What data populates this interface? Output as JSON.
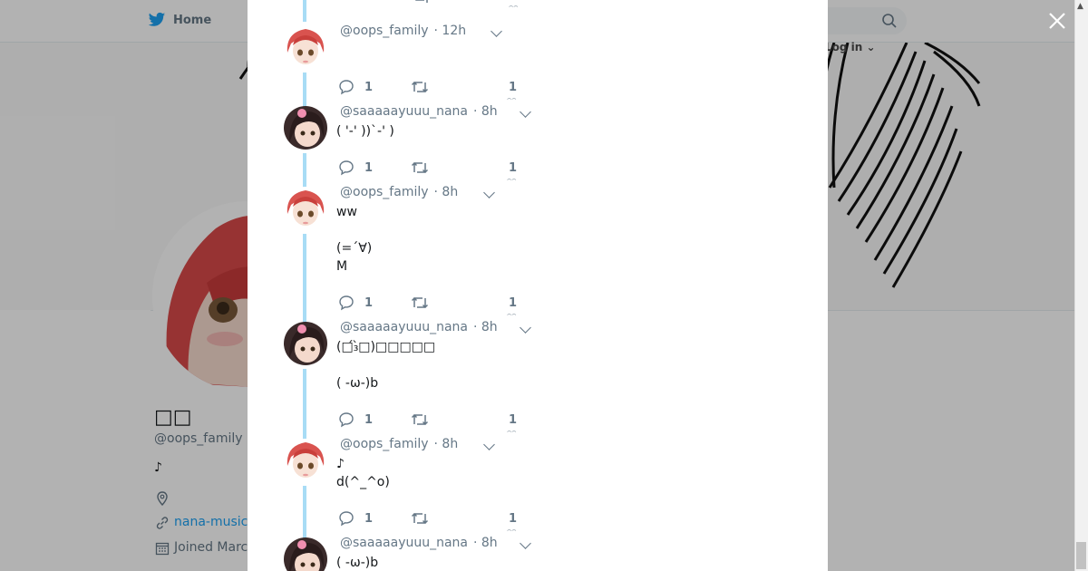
{
  "nav": {
    "home": "Home",
    "login": "Log in"
  },
  "profile": {
    "name": "□□",
    "handle": "@oops_family",
    "bio": "♪",
    "link": "nana-music",
    "joined": "Joined March"
  },
  "thread": {
    "tweets": [
      {
        "handle": "@oops_family",
        "time": "· 12h",
        "text": "",
        "replies": "1",
        "likes": "1"
      },
      {
        "handle": "@saaaaayuuu_nana",
        "time": "· 8h",
        "text": "( '-' ))`-' )",
        "replies": "1",
        "likes": "1"
      },
      {
        "handle": "@oops_family",
        "time": "· 8h",
        "text": "ww\n\n(=´∀)\nM",
        "replies": "1",
        "likes": "1"
      },
      {
        "handle": "@saaaaayuuu_nana",
        "time": "· 8h",
        "text": "(□́₃̀□)□□□□□\n\n( -ω-)b",
        "replies": "1",
        "likes": "1"
      },
      {
        "handle": "@oops_family",
        "time": "· 8h",
        "text": "♪\nd(^_^o)",
        "replies": "1",
        "likes": "1"
      },
      {
        "handle": "@saaaaayuuu_nana",
        "time": "· 8h",
        "text": "( -ω-)b",
        "replies": "",
        "likes": ""
      }
    ]
  },
  "icons": {
    "close": "close-icon",
    "reply": "reply-icon",
    "retweet": "retweet-icon",
    "like": "like-icon",
    "caret": "chevron-down-icon"
  },
  "colors": {
    "accent": "#1da1f2",
    "thread_line": "#a8dcf5",
    "muted": "#657786"
  }
}
